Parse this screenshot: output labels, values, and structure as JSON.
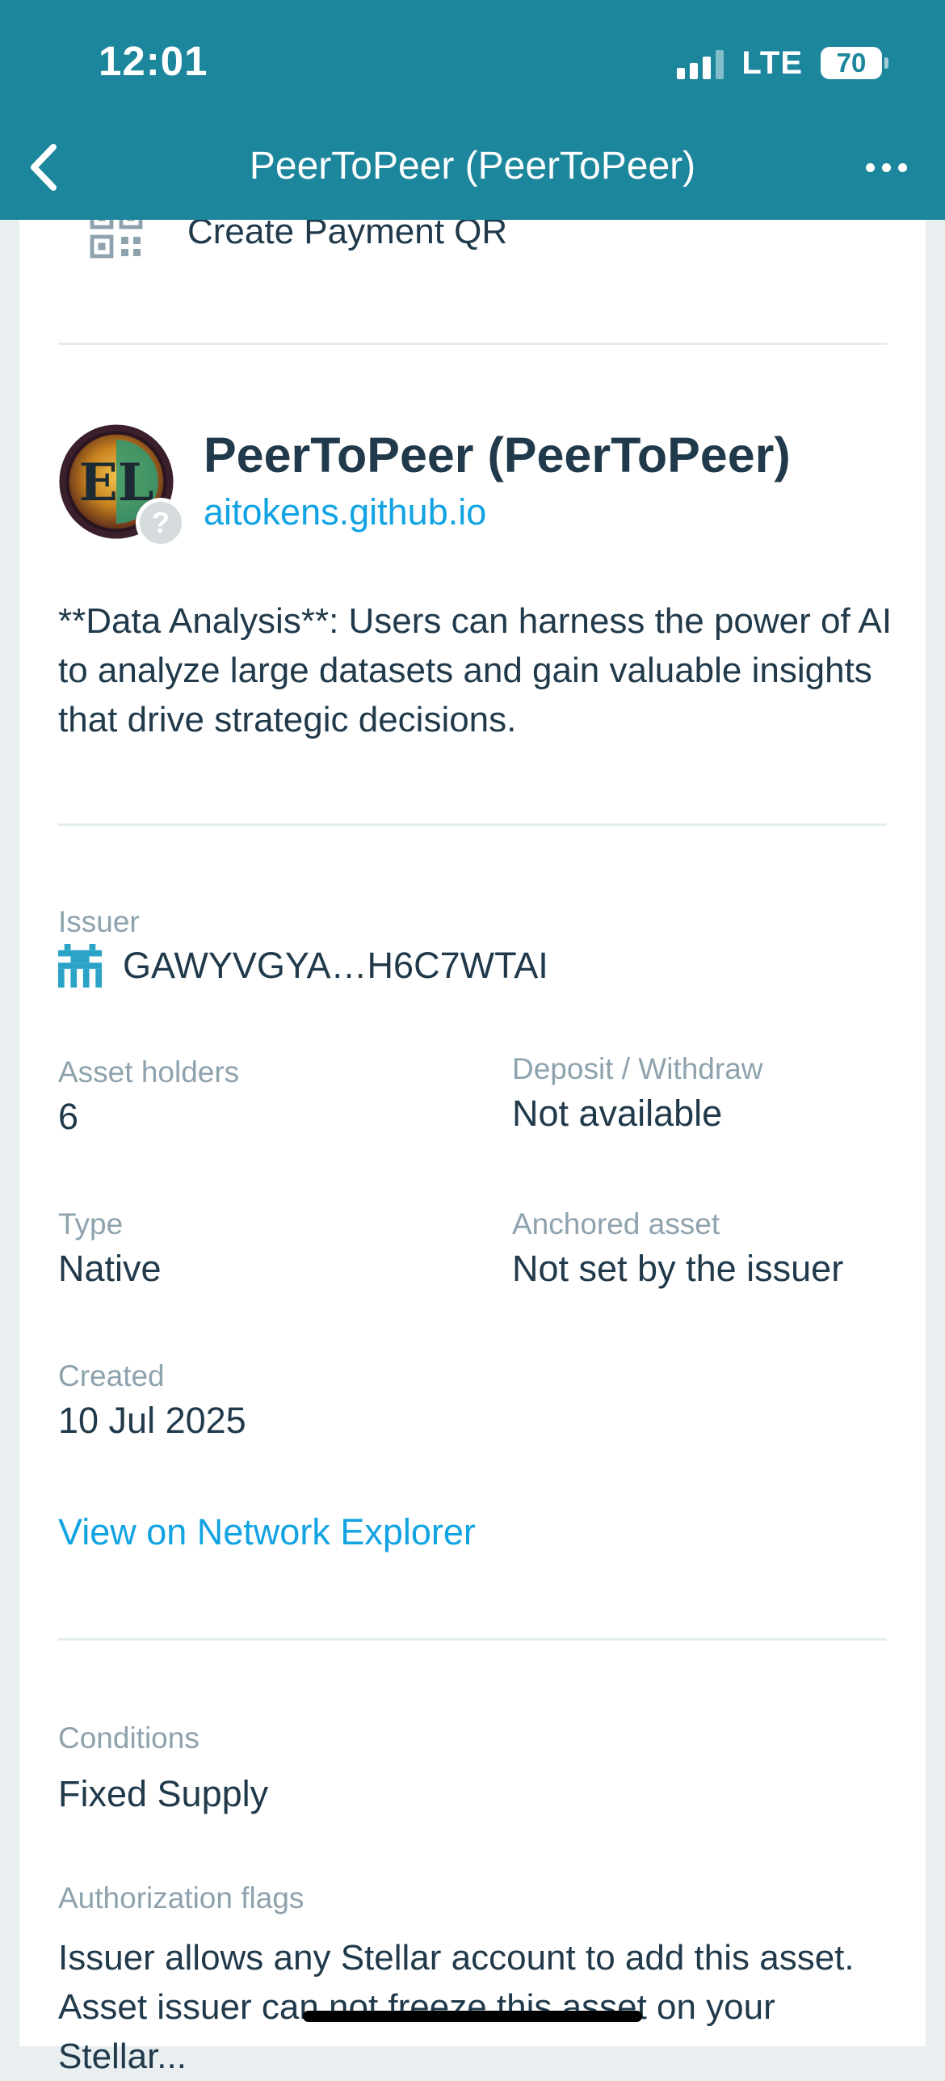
{
  "status_bar": {
    "time": "12:01",
    "network": "LTE",
    "battery": "70"
  },
  "nav": {
    "title": "PeerToPeer (PeerToPeer)"
  },
  "actions": {
    "payment_qr_label": "Create Payment QR"
  },
  "asset": {
    "name": "PeerToPeer (PeerToPeer)",
    "domain": "aitokens.github.io",
    "unverified_badge": "?",
    "description": "**Data Analysis**: Users can harness the power of AI to analyze large datasets and gain valuable insights that drive strategic decisions."
  },
  "details": {
    "issuer_label": "Issuer",
    "issuer_value": "GAWYVGYA…H6C7WTAI",
    "holders_label": "Asset holders",
    "holders_value": "6",
    "deposit_label": "Deposit / Withdraw",
    "deposit_value": "Not available",
    "type_label": "Type",
    "type_value": "Native",
    "anchored_label": "Anchored asset",
    "anchored_value": "Not set by the issuer",
    "created_label": "Created",
    "created_value": "10 Jul 2025",
    "explorer_link": "View on Network Explorer"
  },
  "conditions": {
    "conditions_label": "Conditions",
    "conditions_value": "Fixed Supply",
    "auth_label": "Authorization flags",
    "auth_line1": "Issuer allows any Stellar account to add this asset.",
    "auth_line2": "Asset issuer can not freeze this asset on your",
    "auth_line3": "Stellar..."
  },
  "colors": {
    "header_bg": "#1b869c",
    "link": "#12a3e3",
    "text": "#213a4b",
    "label": "#8ea2ae"
  },
  "icons": [
    "back-chevron-icon",
    "more-dots-icon",
    "qr-code-icon",
    "identicon-icon",
    "question-icon"
  ]
}
